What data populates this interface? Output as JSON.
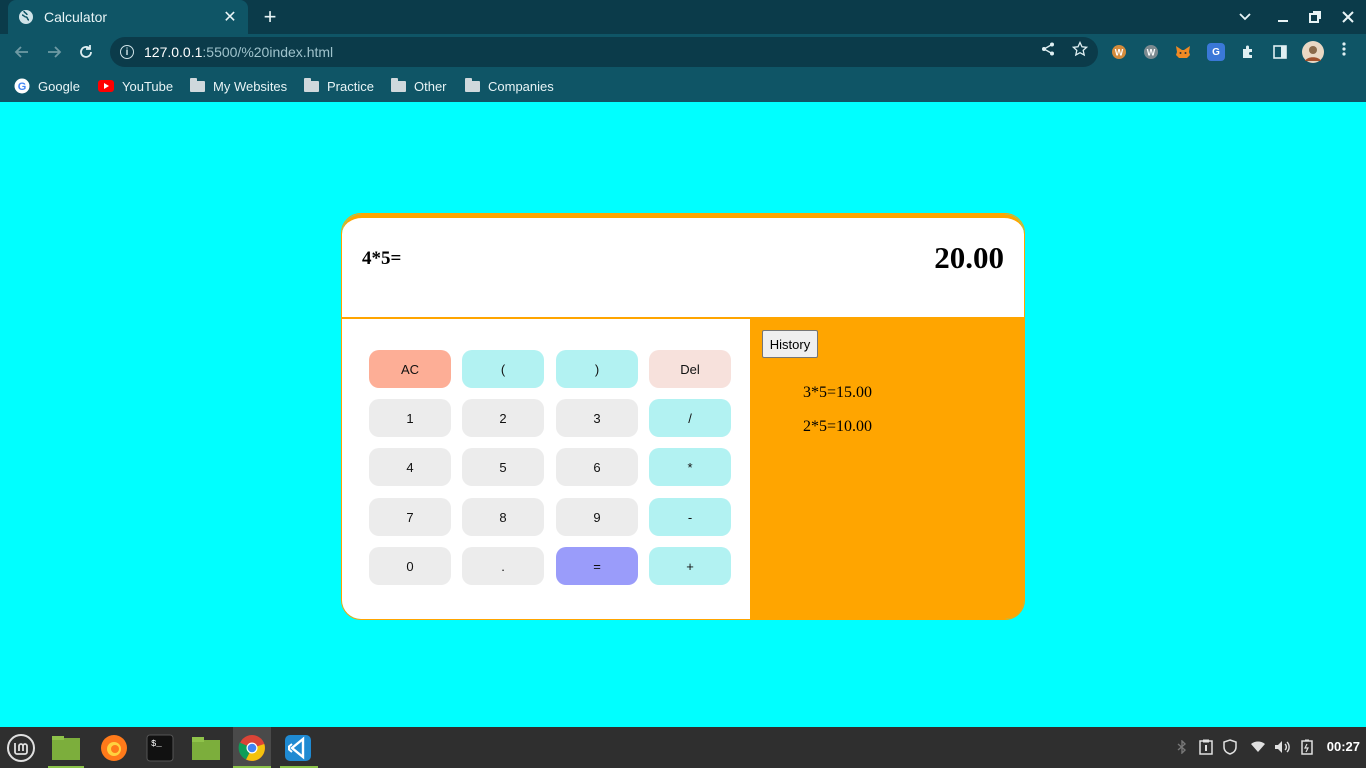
{
  "browser": {
    "tab_title": "Calculator",
    "new_tab": "+",
    "url_host": "127.0.0.1",
    "url_path": ":5500/%20index.html",
    "bookmarks": [
      "Google",
      "YouTube",
      "My Websites",
      "Practice",
      "Other",
      "Companies"
    ]
  },
  "calculator": {
    "expression": "4*5=",
    "result": "20.00",
    "keys": [
      [
        "AC",
        "(",
        ")",
        "Del"
      ],
      [
        "1",
        "2",
        "3",
        "/"
      ],
      [
        "4",
        "5",
        "6",
        "*"
      ],
      [
        "7",
        "8",
        "9",
        "-"
      ],
      [
        "0",
        ".",
        "=",
        "+"
      ]
    ],
    "history_button": "History",
    "history": [
      "3*5=15.00",
      "2*5=10.00"
    ]
  },
  "taskbar": {
    "clock": "00:27"
  },
  "colors": {
    "page_bg": "#00ffff",
    "accent": "#ffa500",
    "key_number": "#ececec",
    "key_operator": "#b2f2f2",
    "key_clear": "#fdae96",
    "key_delete": "#f7e1dc",
    "key_equals": "#9a9cfa"
  }
}
